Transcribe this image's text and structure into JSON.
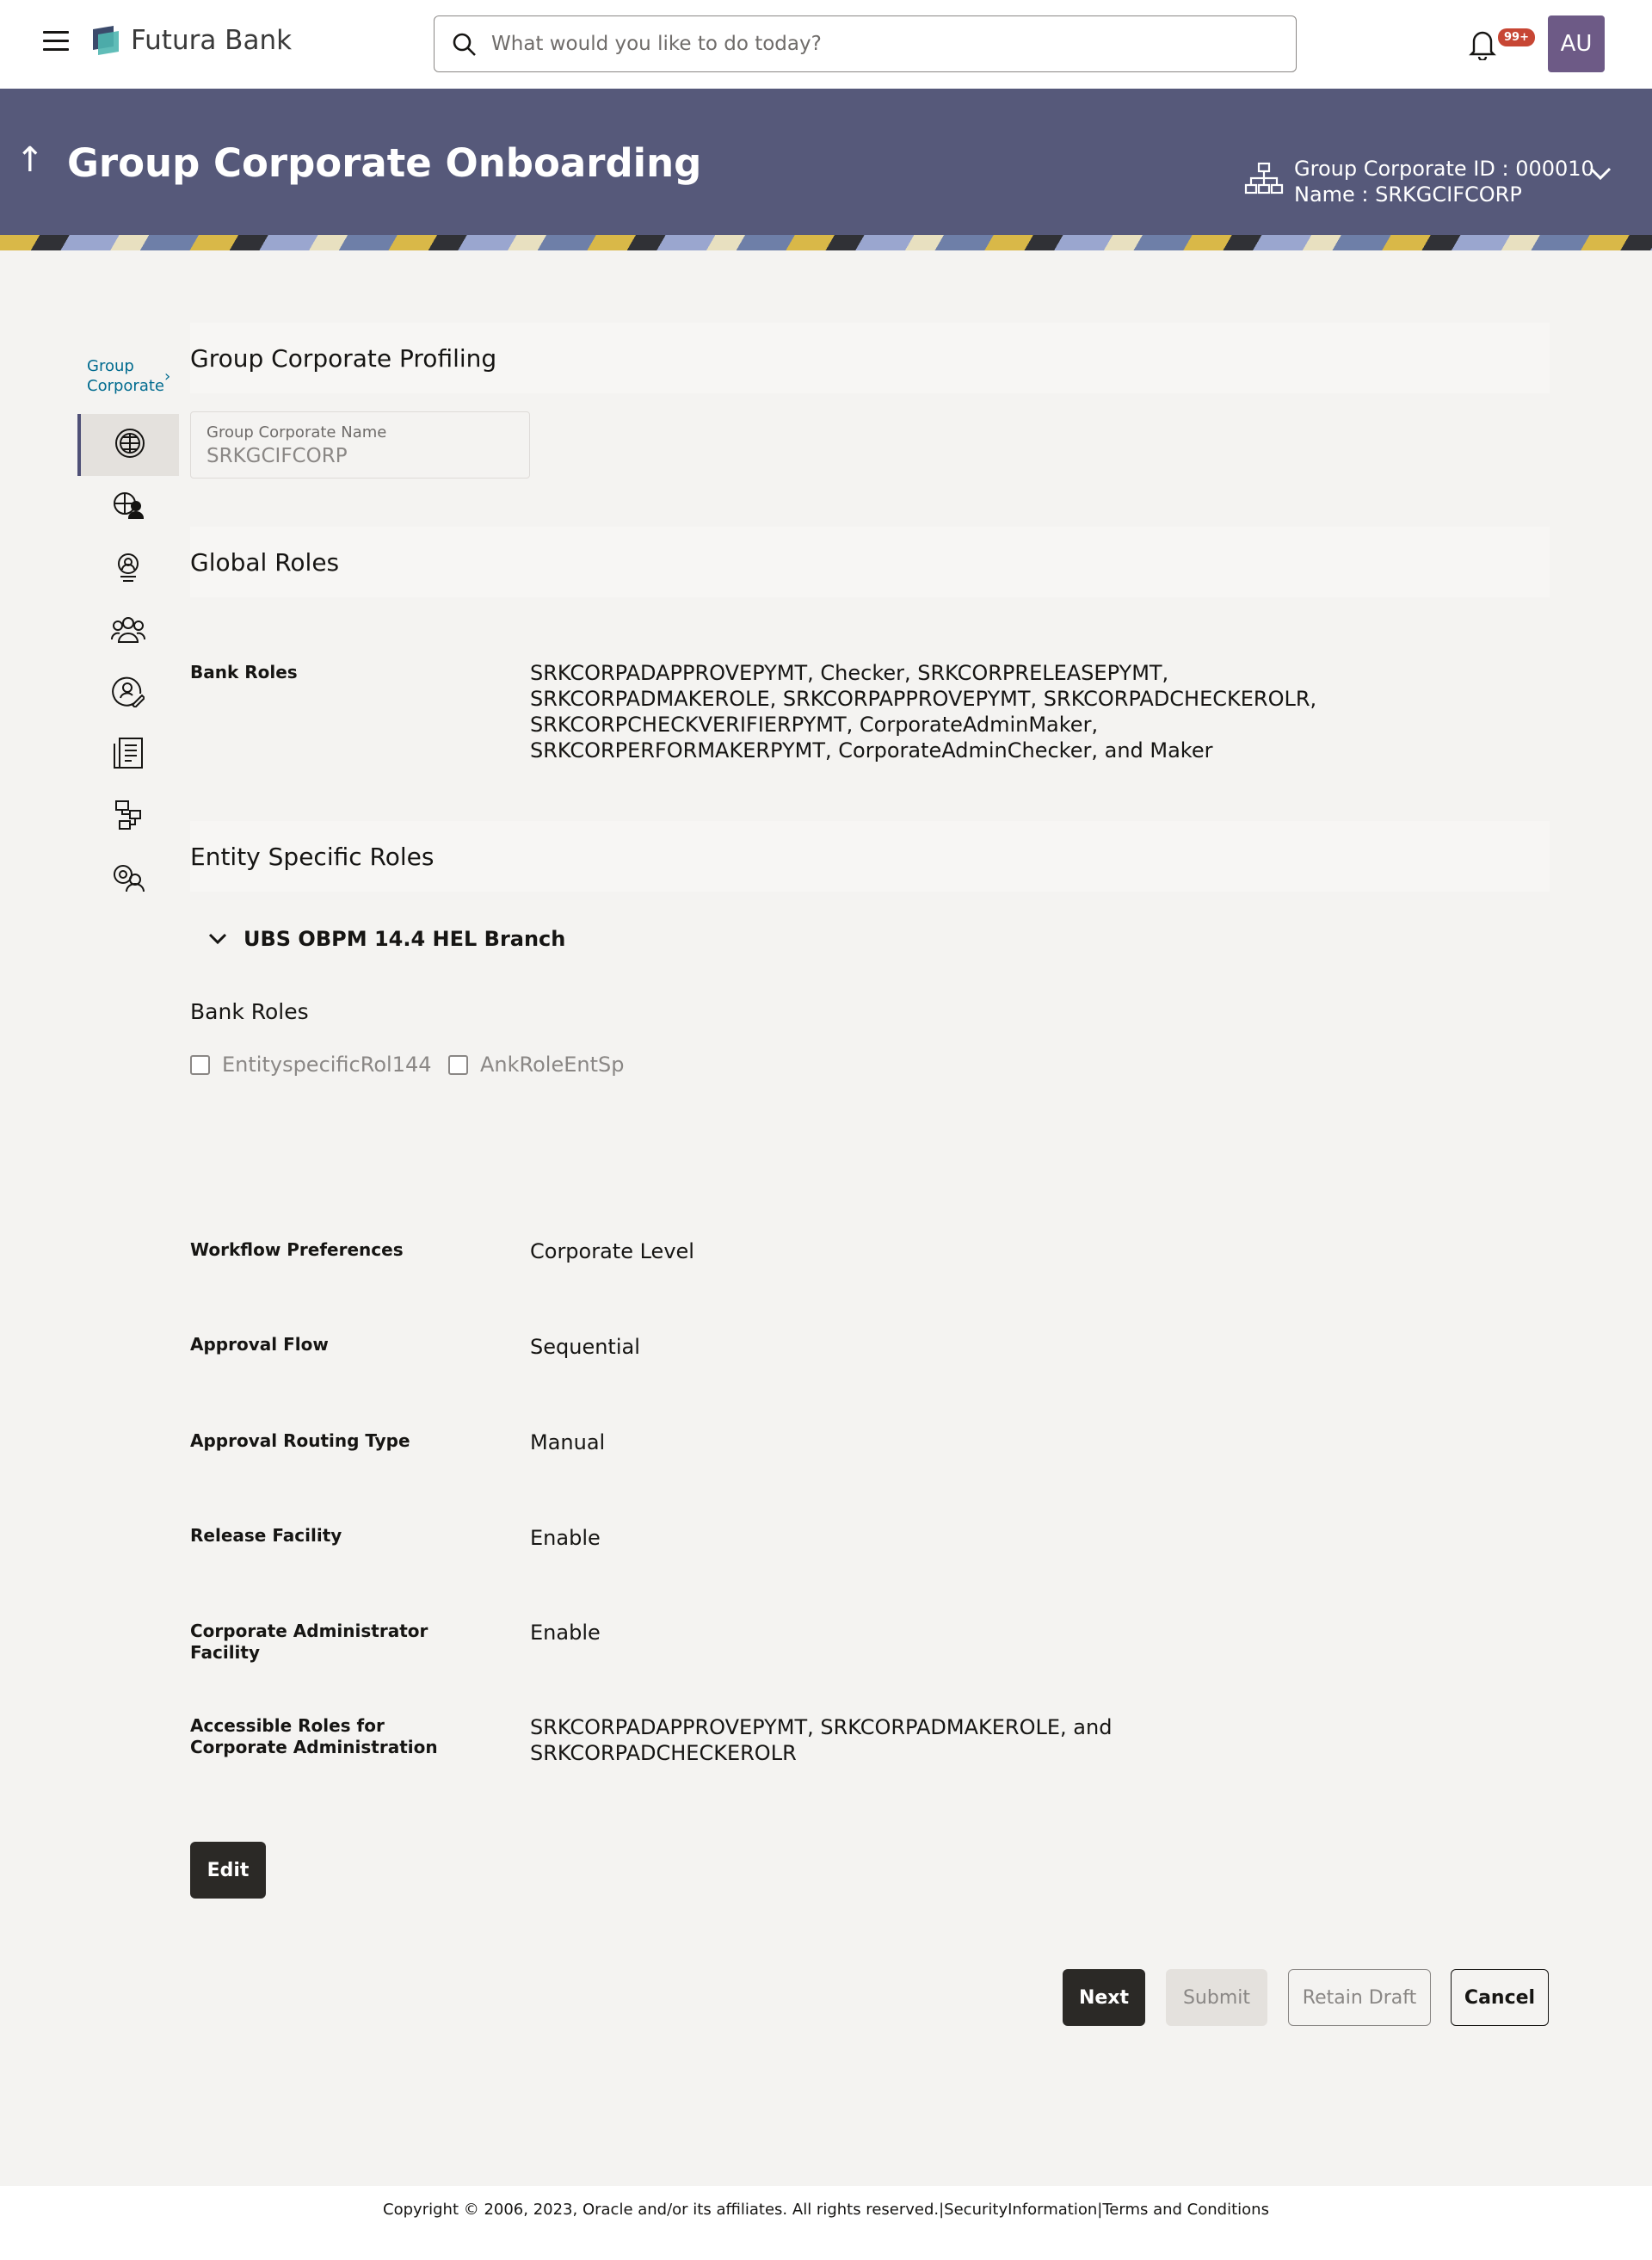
{
  "header": {
    "brand": "Futura Bank",
    "search_placeholder": "What would you like to do today?",
    "notification_badge": "99+",
    "avatar_initials": "AU"
  },
  "banner": {
    "title": "Group Corporate Onboarding",
    "corp_id": "Group Corporate ID : 000010",
    "corp_name": "Name : SRKGCIFCORP"
  },
  "nav": {
    "crumb": "Group Corporate",
    "items": [
      "globe-icon",
      "globe-user-icon",
      "user-badge-icon",
      "users-icon",
      "user-edit-icon",
      "document-list-icon",
      "workflow-icon",
      "settings-group-icon"
    ]
  },
  "profiling": {
    "heading": "Group Corporate Profiling",
    "name_label": "Group Corporate Name",
    "name_value": "SRKGCIFCORP"
  },
  "global_roles": {
    "heading": "Global Roles",
    "bank_roles_label": "Bank Roles",
    "bank_roles_lines": [
      "SRKCORPADAPPROVEPYMT, Checker, SRKCORPRELEASEPYMT,",
      "SRKCORPADMAKEROLE, SRKCORPAPPROVEPYMT, SRKCORPADCHECKEROLR,",
      "SRKCORPCHECKVERIFIERPYMT, CorporateAdminMaker,",
      "SRKCORPERFORMAKERPYMT, CorporateAdminChecker, and Maker"
    ]
  },
  "entity_roles": {
    "heading": "Entity Specific Roles",
    "branch": "UBS OBPM 14.4 HEL Branch",
    "bank_roles_label": "Bank Roles",
    "options": [
      "EntityspecificRol144",
      "AnkRoleEntSp"
    ]
  },
  "details": [
    {
      "label": "Workflow Preferences",
      "value": "Corporate Level"
    },
    {
      "label": "Approval Flow",
      "value": "Sequential"
    },
    {
      "label": "Approval Routing Type",
      "value": "Manual"
    },
    {
      "label": "Release Facility",
      "value": "Enable"
    },
    {
      "label": "Corporate Administrator Facility",
      "value": "Enable"
    },
    {
      "label": "Accessible Roles for Corporate Administration",
      "value": "SRKCORPADAPPROVEPYMT, SRKCORPADMAKEROLE, and SRKCORPADCHECKEROLR"
    }
  ],
  "buttons": {
    "edit": "Edit",
    "next": "Next",
    "submit": "Submit",
    "retain_draft": "Retain Draft",
    "cancel": "Cancel"
  },
  "footer": {
    "copyright": "Copyright © 2006, 2023, Oracle and/or its affiliates. All rights reserved.|SecurityInformation|Terms and Conditions"
  }
}
